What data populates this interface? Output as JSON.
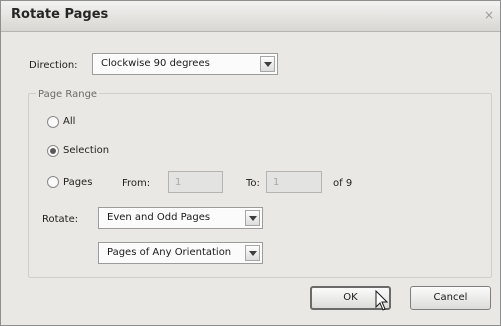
{
  "window": {
    "title": "Rotate Pages",
    "close_glyph": "×"
  },
  "direction": {
    "label": "Direction:",
    "value": "Clockwise 90 degrees"
  },
  "page_range": {
    "title": "Page Range",
    "all_label": "All",
    "selection_label": "Selection",
    "pages_label": "Pages",
    "from_label": "From:",
    "from_value": "1",
    "to_label": "To:",
    "to_value": "1",
    "of_label": "of 9",
    "selected": "selection"
  },
  "rotate": {
    "label": "Rotate:",
    "which_value": "Even and Odd Pages",
    "orientation_value": "Pages of Any Orientation"
  },
  "buttons": {
    "ok": "OK",
    "cancel": "Cancel"
  }
}
